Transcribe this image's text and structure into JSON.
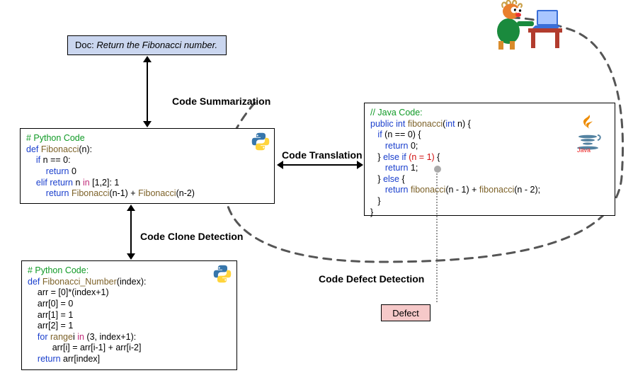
{
  "doc": {
    "prefix": "Doc: ",
    "text": "Return the Fibonacci number."
  },
  "tasks": {
    "summarization": "Code Summarization",
    "translation": "Code Translation",
    "clone": "Code Clone Detection",
    "defect": "Code Defect Detection"
  },
  "defect_label": "Defect",
  "python1": {
    "lang": "python",
    "comment": "# Python Code",
    "lines": [
      {
        "kw": "def ",
        "fn": "Fibonacci",
        "rest": "(n):"
      },
      {
        "indent": "    ",
        "kw": "if ",
        "rest": "n == 0:"
      },
      {
        "indent": "        ",
        "kw": "return ",
        "rest": "0"
      },
      {
        "indent": "    ",
        "kw": "elif ",
        "mid": "n ",
        "op": "in ",
        "rest": "[1,2]: ",
        "kw2": "return ",
        "tail": "1"
      },
      {
        "indent": "        ",
        "kw": "return ",
        "fn": "Fibonacci",
        "rest": "(n-1) + ",
        "fn2": "Fibonacci",
        "tail": "(n-2)"
      }
    ]
  },
  "python2": {
    "lang": "python",
    "comment": "# Python Code:",
    "lines": [
      {
        "kw": "def ",
        "fn": "Fibonacci_Number",
        "rest": "(index):"
      },
      {
        "indent": "    ",
        "rest": "arr = [0]*(index+1)"
      },
      {
        "indent": "    ",
        "rest": "arr[0] = 0"
      },
      {
        "indent": "    ",
        "rest": "arr[1] = 1"
      },
      {
        "indent": "    ",
        "rest": "arr[2] = 1"
      },
      {
        "indent": "    ",
        "kw": "for ",
        "mid": "i ",
        "op": "in ",
        "fn": "range",
        "rest": "(3, index+1):"
      },
      {
        "indent": "          ",
        "rest": "arr[i] = arr[i-1] + arr[i-2]"
      },
      {
        "indent": "    ",
        "kw": "return ",
        "rest": "arr[index]"
      }
    ]
  },
  "java": {
    "lang": "java",
    "comment": "// Java Code:",
    "lines": [
      {
        "kw": "public ",
        "kw2": "int ",
        "fn": "fibonacci",
        "rest": "(",
        "kw3": "int ",
        "tail": "n) {"
      },
      {
        "indent": "   ",
        "kw": "if ",
        "rest": "(n == 0) {"
      },
      {
        "indent": "      ",
        "kw": "return ",
        "rest": "0;"
      },
      {
        "indent": "   ",
        "rest": "} ",
        "kw": "else if ",
        "err": "(n = 1)",
        "tail": " {"
      },
      {
        "indent": "      ",
        "kw": "return ",
        "rest": "1;"
      },
      {
        "indent": "   ",
        "rest": "} ",
        "kw": "else ",
        "tail": "{"
      },
      {
        "indent": "      ",
        "kw": "return ",
        "fn": "fibonacci",
        "rest": "(n - 1) + ",
        "fn2": "fibonacci",
        "tail": "(n - 2);"
      },
      {
        "indent": "   ",
        "rest": "}"
      },
      {
        "rest": "}"
      }
    ]
  },
  "icons": {
    "python": "python-logo",
    "java": "java-logo",
    "cartoon": "cartoon-person-at-laptop"
  }
}
